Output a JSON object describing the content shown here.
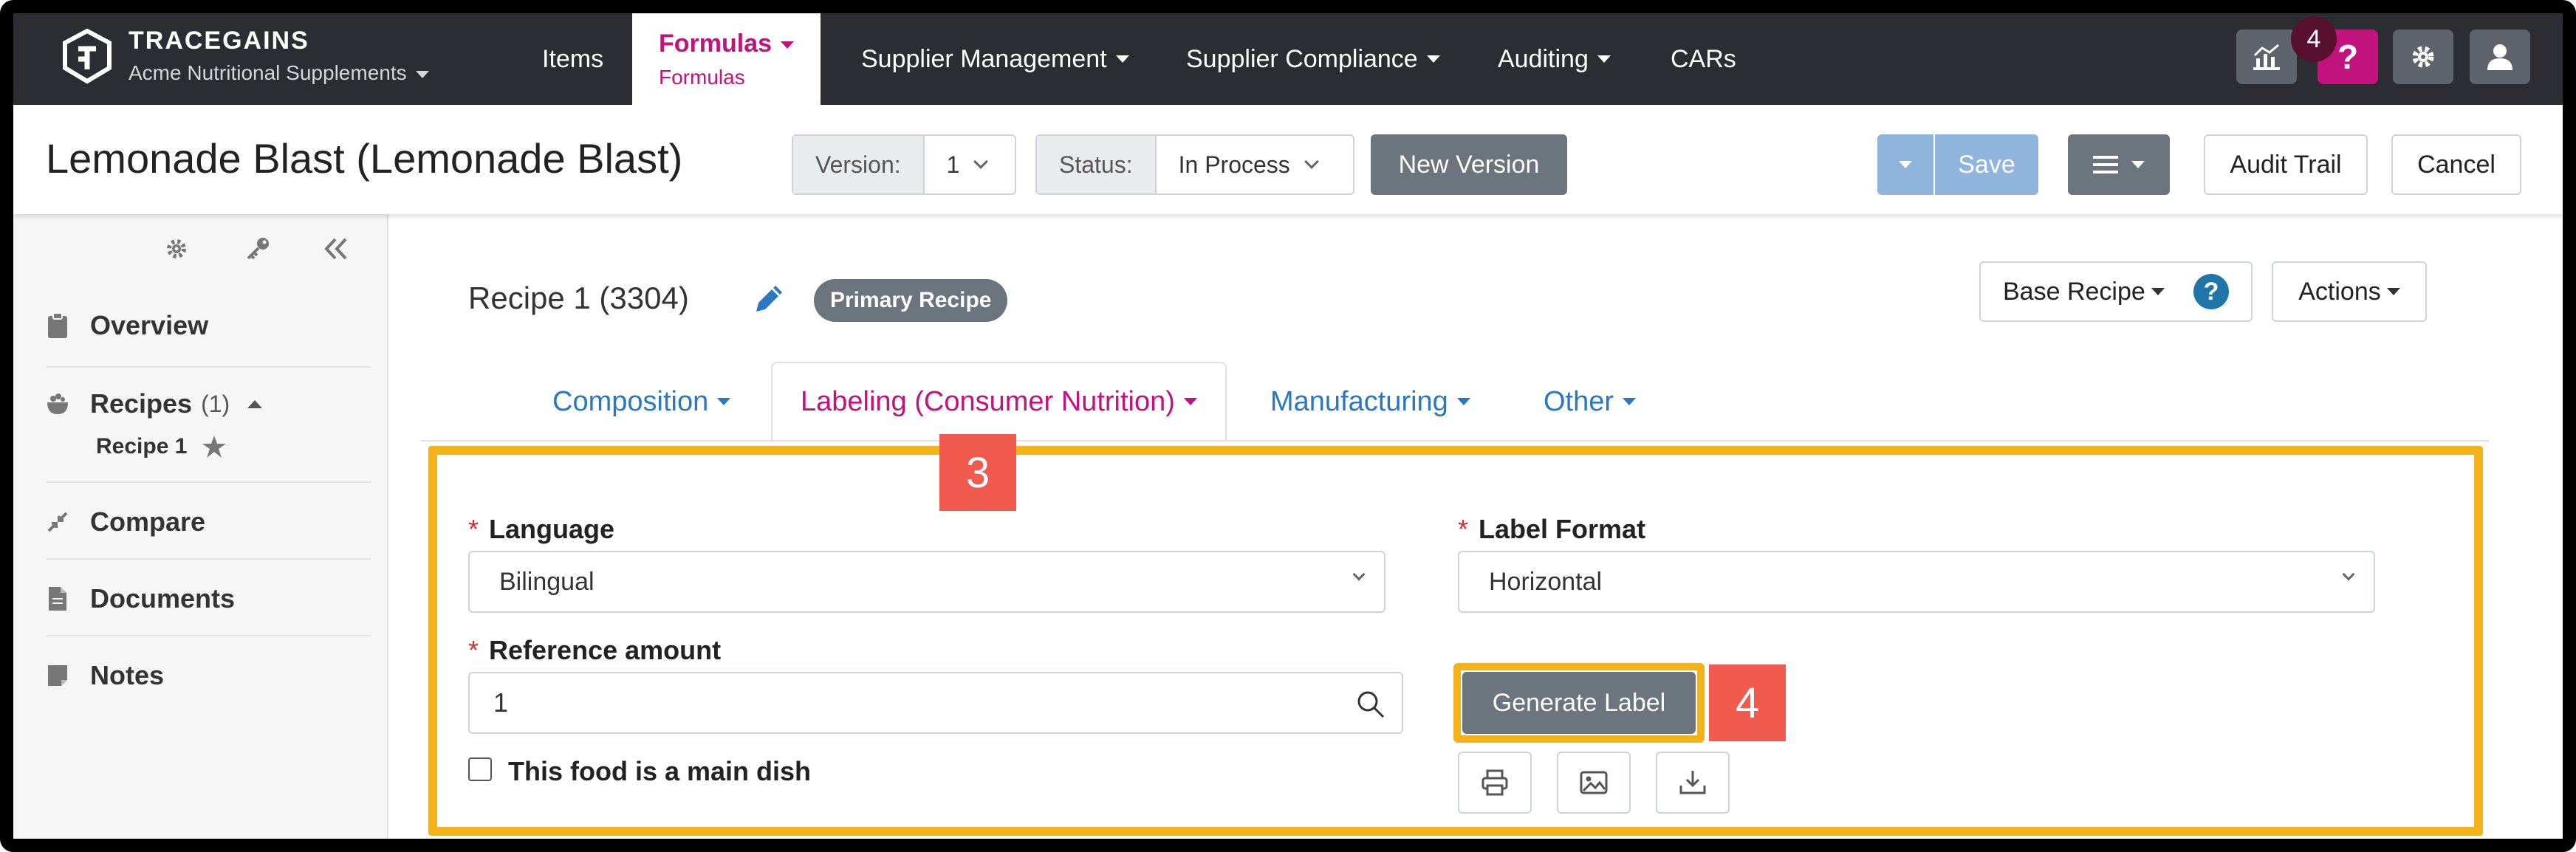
{
  "brand": {
    "name": "TRACEGAINS",
    "org": "Acme Nutritional Supplements"
  },
  "nav": {
    "items": [
      "Items",
      "Supplier Management",
      "Supplier Compliance",
      "Auditing",
      "CARs"
    ],
    "active": {
      "title": "Formulas",
      "sub": "Formulas"
    },
    "badge": "4",
    "help_label": "?"
  },
  "header": {
    "title": "Lemonade Blast (Lemonade Blast)",
    "version_label": "Version:",
    "version_value": "1",
    "status_label": "Status:",
    "status_value": "In Process",
    "new_version": "New Version",
    "save": "Save",
    "audit_trail": "Audit Trail",
    "cancel": "Cancel"
  },
  "sidebar": {
    "overview": "Overview",
    "recipes": "Recipes",
    "recipes_count": "(1)",
    "recipe_1": "Recipe 1",
    "compare": "Compare",
    "documents": "Documents",
    "notes": "Notes"
  },
  "main": {
    "recipe_title": "Recipe 1 (3304)",
    "primary_pill": "Primary Recipe",
    "base_recipe": "Base Recipe",
    "actions": "Actions",
    "tabs": [
      "Composition",
      "Labeling (Consumer Nutrition)",
      "Manufacturing",
      "Other"
    ],
    "active_tab": 1
  },
  "form": {
    "language_label": "Language",
    "language_value": "Bilingual",
    "label_format_label": "Label Format",
    "label_format_value": "Horizontal",
    "reference_label": "Reference amount",
    "reference_value": "1",
    "main_dish_label": "This food is a main dish",
    "generate_label": "Generate Label"
  },
  "callouts": {
    "tab": "3",
    "button": "4"
  },
  "colors": {
    "nav_bg": "#2b2d33",
    "accent": "#c2127e",
    "link": "#2b78c2",
    "highlight": "#f4b21a",
    "callout": "#f15a4f",
    "save_button": "#8fb5dc"
  }
}
